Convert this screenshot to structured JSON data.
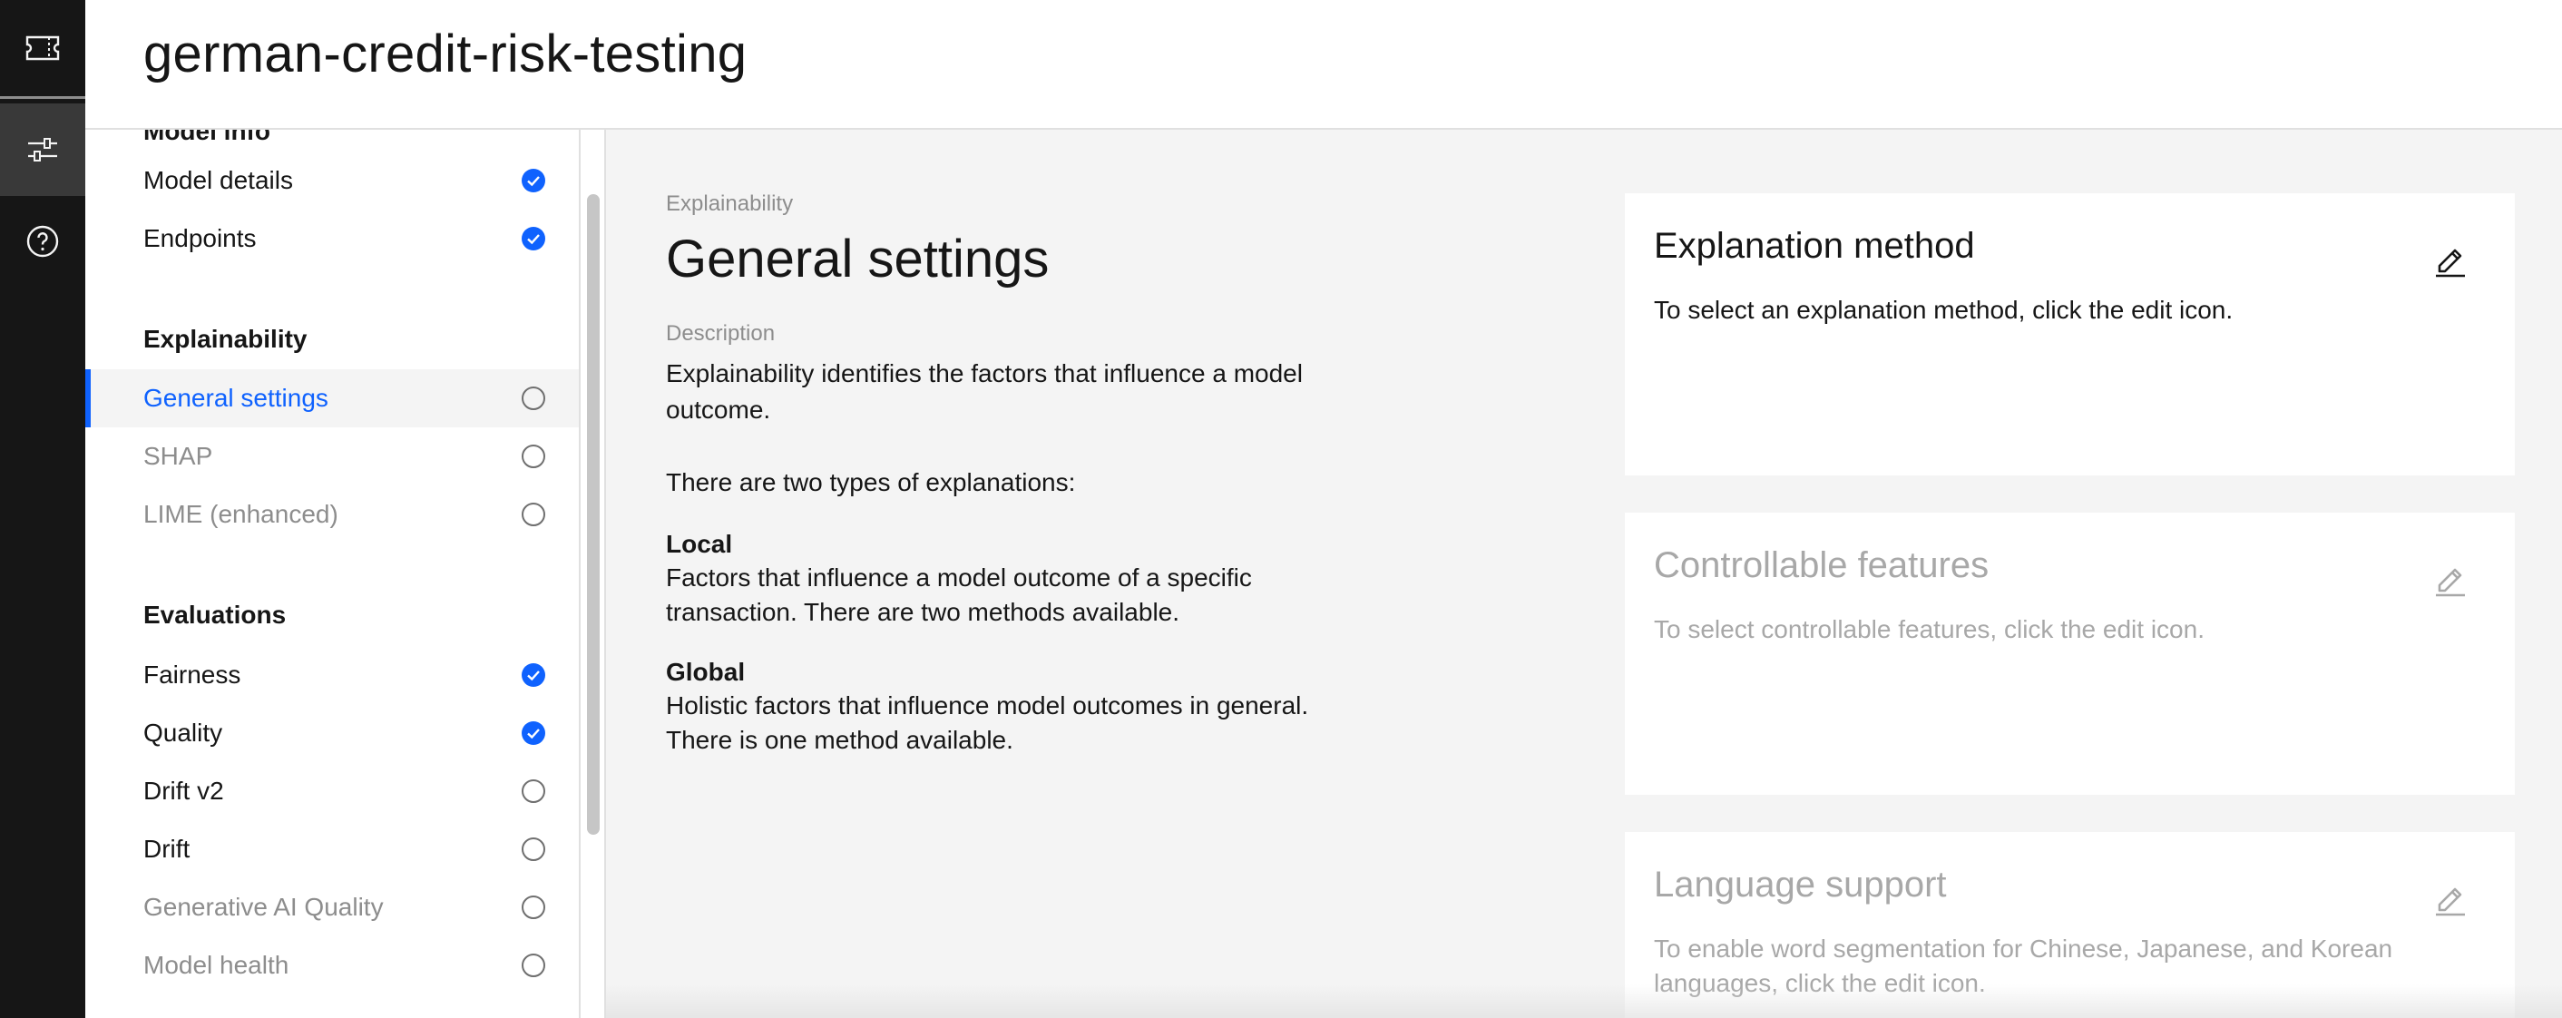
{
  "header": {
    "title": "german-credit-risk-testing"
  },
  "rail": {
    "items": [
      {
        "icon": "ticket-icon"
      },
      {
        "icon": "sliders-icon",
        "active": true
      },
      {
        "icon": "help-icon"
      }
    ]
  },
  "sidenav": {
    "clipped_group": "Model info",
    "model_items": [
      {
        "label": "Model details",
        "status": "complete"
      },
      {
        "label": "Endpoints",
        "status": "complete"
      }
    ],
    "explainability_group": "Explainability",
    "explainability_items": [
      {
        "label": "General settings",
        "status": "incomplete",
        "active": true
      },
      {
        "label": "SHAP",
        "status": "incomplete",
        "disabled": true
      },
      {
        "label": "LIME (enhanced)",
        "status": "incomplete",
        "disabled": true
      }
    ],
    "evaluations_group": "Evaluations",
    "evaluation_items": [
      {
        "label": "Fairness",
        "status": "complete"
      },
      {
        "label": "Quality",
        "status": "complete"
      },
      {
        "label": "Drift v2",
        "status": "incomplete"
      },
      {
        "label": "Drift",
        "status": "incomplete"
      },
      {
        "label": "Generative AI Quality",
        "status": "incomplete",
        "disabled": true
      },
      {
        "label": "Model health",
        "status": "incomplete",
        "disabled": true
      }
    ]
  },
  "main": {
    "eyebrow": "Explainability",
    "title": "General settings",
    "description_label": "Description",
    "description": "Explainability identifies the factors that influence a model outcome.",
    "types_intro": "There are two types of explanations:",
    "local_heading": "Local",
    "local_text": "Factors that influence a model outcome of a specific transaction. There are two methods available.",
    "global_heading": "Global",
    "global_text": "Holistic factors that influence model outcomes in general. There is one method available."
  },
  "cards": [
    {
      "title": "Explanation method",
      "description": "To select an explanation method, click the edit icon.",
      "enabled": true
    },
    {
      "title": "Controllable features",
      "description": "To select controllable features, click the edit icon.",
      "enabled": false
    },
    {
      "title": "Language support",
      "description": "To enable word segmentation for Chinese, Japanese, and Korean languages, click the edit icon.",
      "enabled": false
    }
  ],
  "colors": {
    "accent": "#0f62fe",
    "rail_bg": "#161616",
    "muted_text": "#8d8d8d"
  }
}
